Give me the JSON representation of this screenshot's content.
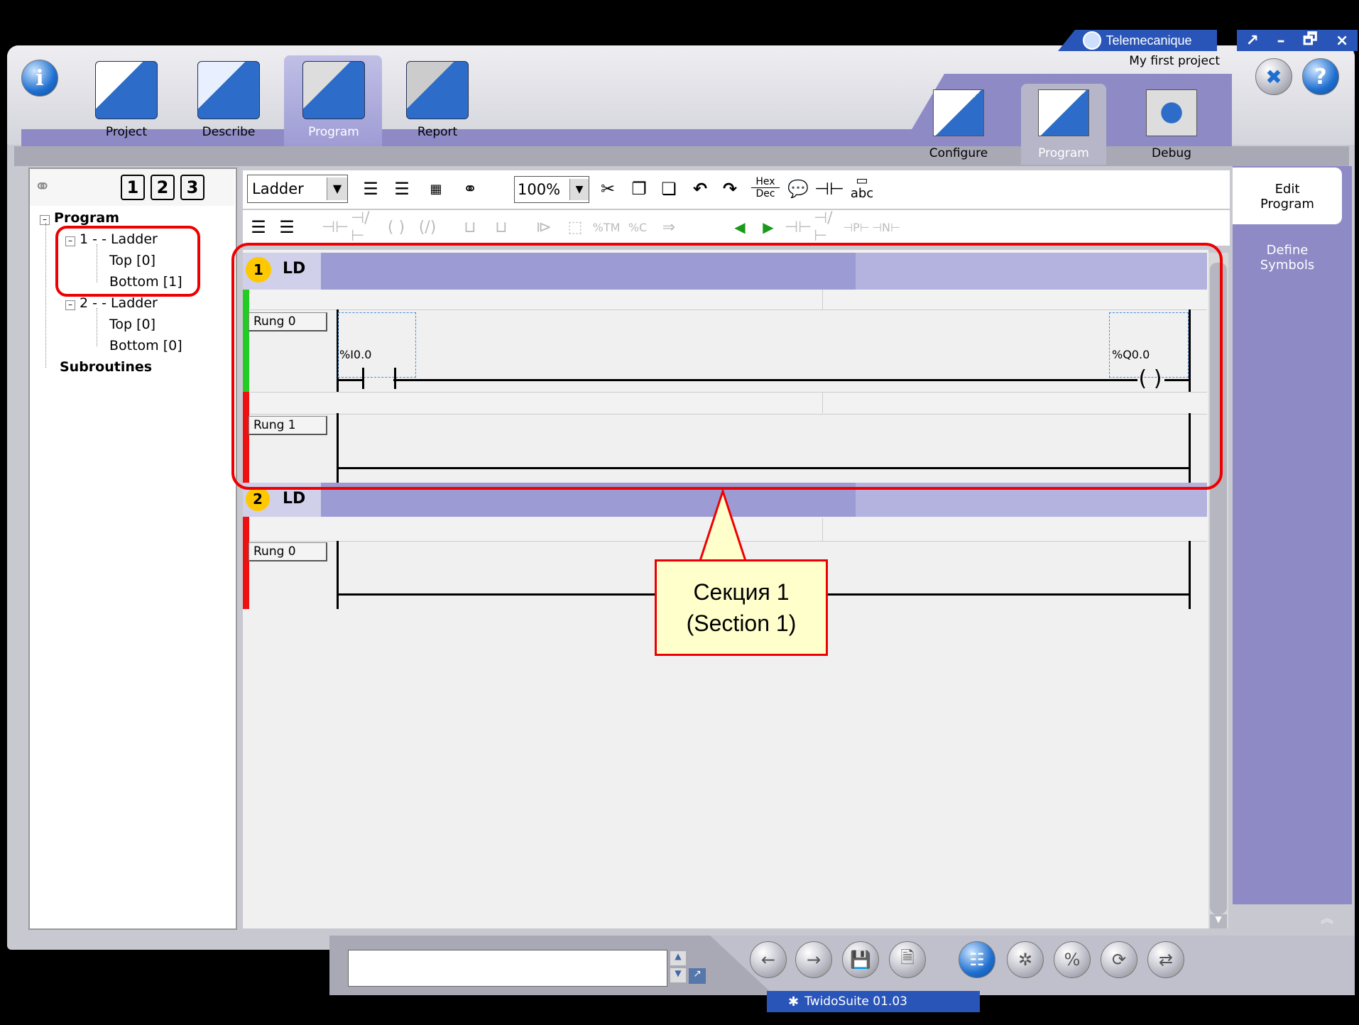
{
  "window": {
    "brand": "Telemecanique",
    "project_name": "My first project",
    "controls": [
      "↗",
      "–",
      "🗗",
      "×"
    ]
  },
  "main_tabs": [
    {
      "label": "Project",
      "icon": "project-folder-icon"
    },
    {
      "label": "Describe",
      "icon": "describe-folder-icon"
    },
    {
      "label": "Program",
      "icon": "program-folder-icon",
      "active": true
    },
    {
      "label": "Report",
      "icon": "report-folder-icon"
    }
  ],
  "sub_tabs": [
    {
      "label": "Configure",
      "icon": "configure-icon"
    },
    {
      "label": "Program",
      "icon": "program-sub-icon",
      "active": true
    },
    {
      "label": "Debug",
      "icon": "debug-icon"
    }
  ],
  "left_pane": {
    "buttons": [
      "1",
      "2",
      "3"
    ],
    "tree": {
      "root": "Program",
      "sections": [
        {
          "label": "1 -  - Ladder",
          "children": [
            "Top [0]",
            "Bottom [1]"
          ]
        },
        {
          "label": "2 -  - Ladder",
          "children": [
            "Top [0]",
            "Bottom [0]"
          ]
        }
      ],
      "subroutines": "Subroutines"
    }
  },
  "toolbar": {
    "language": "Ladder",
    "zoom": "100%",
    "hex": "Hex",
    "dec": "Dec",
    "abc": "abc"
  },
  "sections": [
    {
      "number": "1",
      "type": "LD",
      "rungs": [
        {
          "label": "Rung 0",
          "contact": "%I0.0",
          "coil": "%Q0.0",
          "status": "green"
        },
        {
          "label": "Rung 1",
          "status": "red"
        }
      ]
    },
    {
      "number": "2",
      "type": "LD",
      "rungs": [
        {
          "label": "Rung 0",
          "status": "red"
        }
      ]
    }
  ],
  "right_panel": {
    "edit_program": [
      "Edit",
      "Program"
    ],
    "define_symbols": [
      "Define",
      "Symbols"
    ]
  },
  "callout": {
    "line1": "Секция 1",
    "line2": "(Section 1)"
  },
  "status": {
    "version": "TwidoSuite 01.03"
  },
  "colors": {
    "accent_purple": "#8d8ac6",
    "section_head": "#a2a2d8",
    "rung_ok": "#22cc22",
    "rung_err": "#ee1111",
    "highlight": "#ee0000"
  }
}
